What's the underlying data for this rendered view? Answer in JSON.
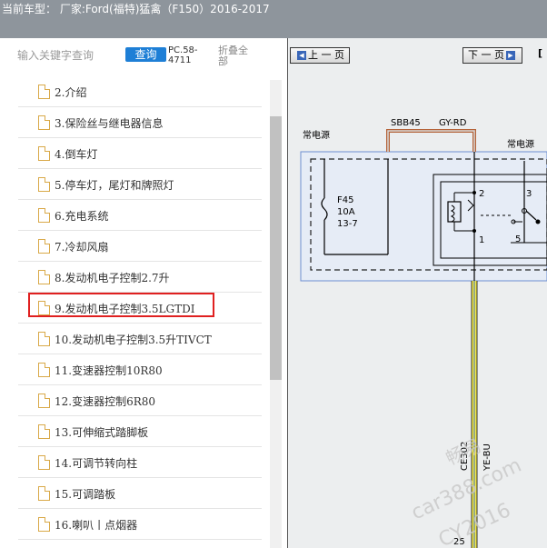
{
  "title_bar": {
    "vehicle_text": "当前车型： 厂家:Ford(福特)猛禽（F150）2016-2017"
  },
  "toolbar": {
    "search_placeholder": "输入关键字查询",
    "search_button": "查询",
    "doc_code": "PC.58-4711",
    "collapse_all": "折叠全部"
  },
  "toc": {
    "items": [
      {
        "label": "2.介绍"
      },
      {
        "label": "3.保险丝与继电器信息"
      },
      {
        "label": "4.倒车灯"
      },
      {
        "label": "5.停车灯，尾灯和牌照灯"
      },
      {
        "label": "6.充电系统"
      },
      {
        "label": "7.冷却风扇"
      },
      {
        "label": "8.发动机电子控制2.7升"
      },
      {
        "label": "9.发动机电子控制3.5LGTDI",
        "selected": true
      },
      {
        "label": "10.发动机电子控制3.5升TIVCT"
      },
      {
        "label": "11.变速器控制10R80"
      },
      {
        "label": "12.变速器控制6R80"
      },
      {
        "label": "13.可伸缩式踏脚板"
      },
      {
        "label": "14.可调节转向柱"
      },
      {
        "label": "15.可调踏板"
      },
      {
        "label": "16.喇叭丨点烟器"
      }
    ]
  },
  "viewer": {
    "prev_label": "上 一 页",
    "next_label": "下 一 页",
    "page_bracket": "[",
    "diagram": {
      "labels": {
        "left_power": "常电源",
        "right_power": "常电源",
        "fuse_box": "SBB45",
        "wire_color_top": "GY-RD",
        "fuse_name": "F45",
        "fuse_rating": "10A",
        "fuse_ref": "13-7",
        "pin_2": "2",
        "pin_3": "3",
        "pin_1": "1",
        "pin_5": "5",
        "circuit_id": "CE302",
        "wire_color": "YE-BU",
        "connector_pin": "25"
      },
      "watermarks": [
        "畅易",
        "car388.com",
        "CY2016"
      ]
    }
  }
}
